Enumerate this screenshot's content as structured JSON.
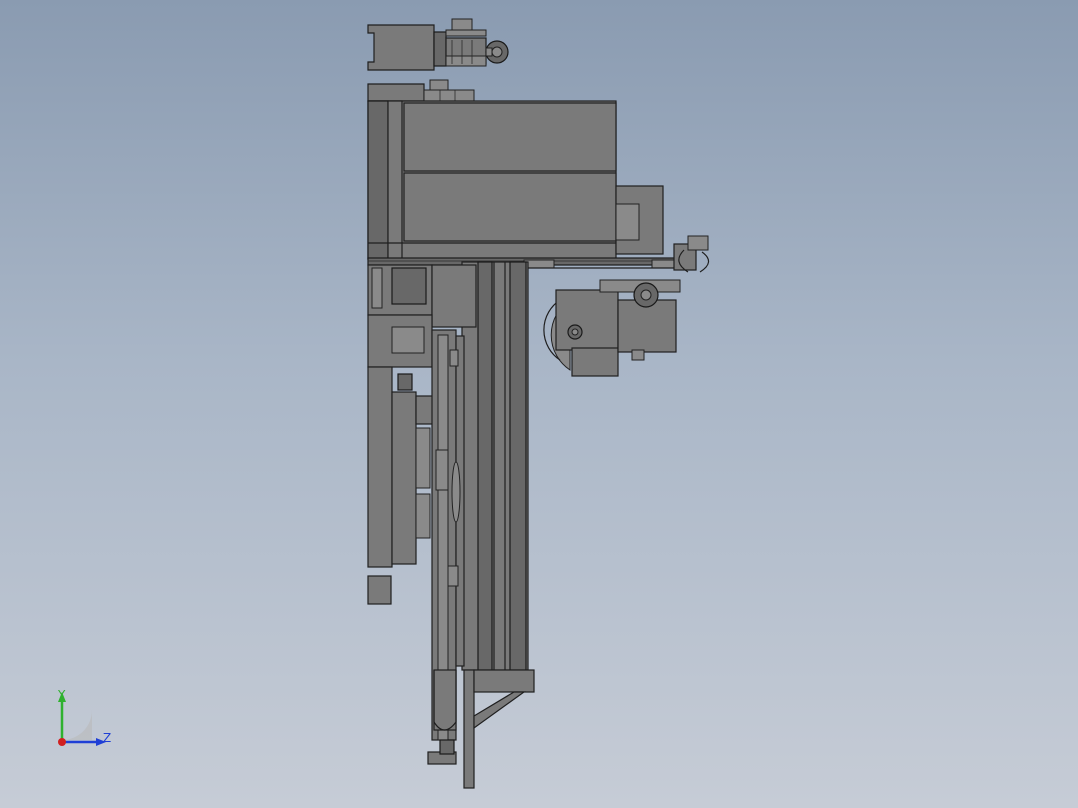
{
  "viewport": {
    "background_top": "#8a9bb1",
    "background_bottom": "#c6ccd6",
    "part_fill": "#7a7a7a",
    "edge_color": "#1f1f1f"
  },
  "model": {
    "view": "side",
    "icon": "mechanical-assembly"
  },
  "triad": {
    "y_label": "Y",
    "z_label": "Z",
    "y_color": "#2fb12f",
    "z_color": "#1f3fd6",
    "x_color": "#d02020"
  }
}
